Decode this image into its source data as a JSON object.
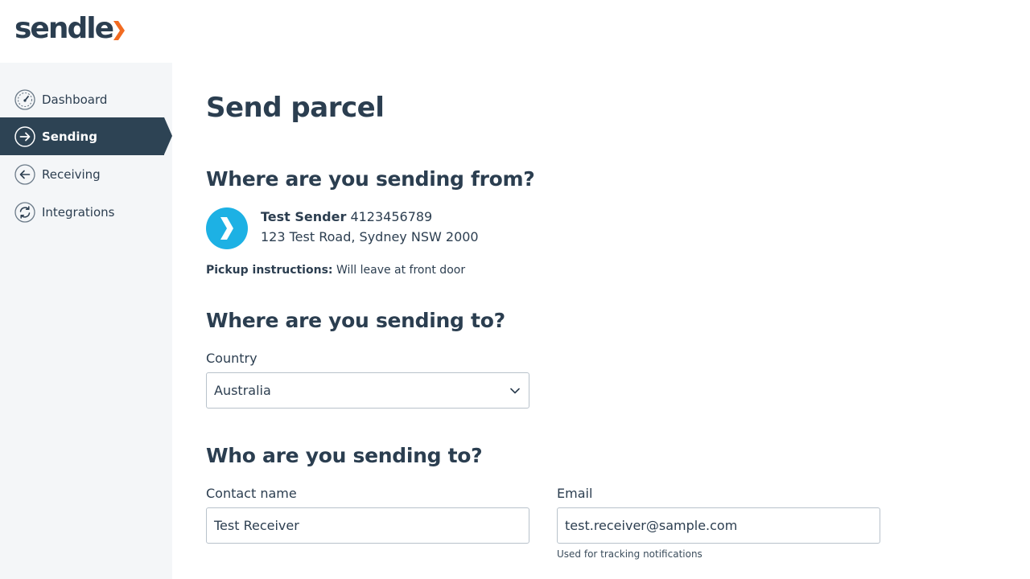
{
  "brand": {
    "logo_text": "sendle",
    "accent_color": "#f26b21",
    "primary_color": "#2b3e50",
    "avatar_color": "#1db1e4"
  },
  "sidebar": {
    "items": [
      {
        "label": "Dashboard",
        "icon": "speedometer-icon",
        "active": false
      },
      {
        "label": "Sending",
        "icon": "arrow-right-circle-icon",
        "active": true
      },
      {
        "label": "Receiving",
        "icon": "arrow-left-circle-icon",
        "active": false
      },
      {
        "label": "Integrations",
        "icon": "refresh-circle-icon",
        "active": false
      }
    ]
  },
  "page": {
    "title": "Send parcel"
  },
  "from_section": {
    "heading": "Where are you sending from?",
    "sender_name": "Test Sender",
    "sender_phone": "4123456789",
    "sender_address": "123 Test Road, Sydney NSW 2000",
    "pickup_label": "Pickup instructions:",
    "pickup_value": "Will leave at front door"
  },
  "to_section": {
    "heading": "Where are you sending to?",
    "country_label": "Country",
    "country_value": "Australia"
  },
  "who_section": {
    "heading": "Who are you sending to?",
    "contact_label": "Contact name",
    "contact_value": "Test Receiver",
    "email_label": "Email",
    "email_value": "test.receiver@sample.com",
    "email_helper": "Used for tracking notifications"
  }
}
